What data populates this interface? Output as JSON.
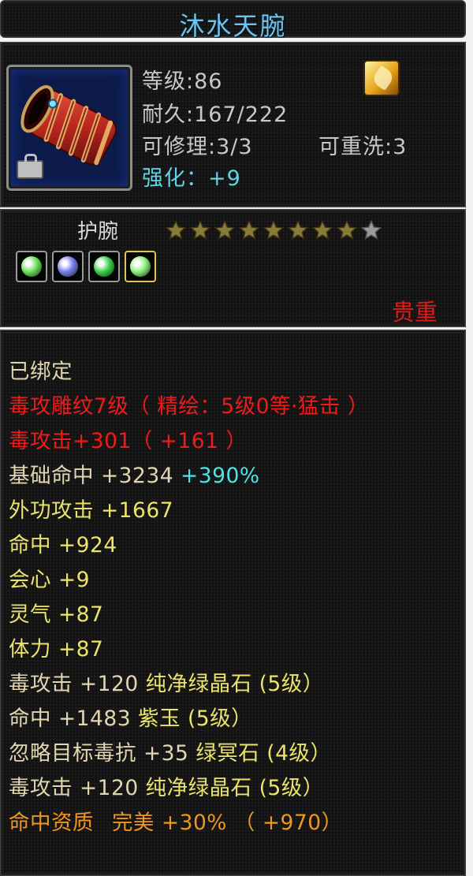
{
  "item": {
    "name": "沐水天腕",
    "level_text": "等级:86",
    "durability_text": "耐久:167/222",
    "repairable_text": "可修理:3/3",
    "rewash_text": "可重洗:3",
    "enhance_label": "强化：",
    "enhance_value": "+9",
    "type": "护腕",
    "rarity": "贵重",
    "stars_filled": 8,
    "stars_total": 9
  },
  "gems": [
    {
      "icon": "green-crystal-gem-icon",
      "color": "#6ee05a"
    },
    {
      "icon": "purple-jade-gem-icon",
      "color": "#7a7cf0"
    },
    {
      "icon": "green-ore-gem-icon",
      "color": "#3fd04a"
    },
    {
      "icon": "green-crystal-gem-icon",
      "color": "#8ff07a"
    }
  ],
  "stats": {
    "bound": "已绑定",
    "engrave": "毒攻雕纹7级（ 精绘：5级0等·猛击 ）",
    "poison_attack": {
      "label": "毒攻击",
      "value": "+301",
      "bonus": "（ +161 ）"
    },
    "base_hit": {
      "label": "基础命中",
      "value": "+3234",
      "pct": "+390%"
    },
    "outer_attack": {
      "label": "外功攻击",
      "value": "+1667"
    },
    "hit": {
      "label": "命中",
      "value": "+924"
    },
    "crit": {
      "label": "会心",
      "value": "+9"
    },
    "spirit": {
      "label": "灵气",
      "value": "+87"
    },
    "stamina": {
      "label": "体力",
      "value": "+87"
    },
    "gem1": {
      "label": "毒攻击",
      "value": "+120",
      "gem": "纯净绿晶石 (5级）"
    },
    "gem2": {
      "label": "命中",
      "value": "+1483",
      "gem": "紫玉 (5级）"
    },
    "gem3": {
      "label": "忽略目标毒抗",
      "value": "+35",
      "gem": "绿冥石 (4级）"
    },
    "gem4": {
      "label": "毒攻击",
      "value": "+120",
      "gem": "纯净绿晶石 (5级）"
    },
    "aptitude": {
      "label": "命中资质",
      "quality": "完美",
      "value": "+30%",
      "bonus": "（ +970）"
    }
  },
  "colors": {
    "title": "#6fc2ec",
    "rarity": "#e01b1b",
    "red_stat": "#ef1b1b",
    "yellow_stat": "#ece36a",
    "beige_stat": "#e1d6b0",
    "orange_stat": "#ee9620",
    "cyan_stat": "#48e6e6"
  }
}
